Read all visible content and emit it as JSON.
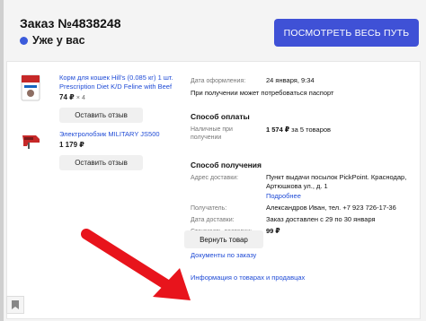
{
  "order": {
    "title": "Заказ №4838248",
    "status": "Уже у вас",
    "track_button": "ПОСМОТРЕТЬ ВЕСЬ ПУТЬ"
  },
  "products": [
    {
      "name": "Корм для кошек Hill's (0.085 кг) 1 шт. Prescription Diet K/D Feline with Beef",
      "price": "74 ₽",
      "qty": "× 4",
      "review_button": "Оставить отзыв",
      "icon": "cat-food-pack-icon"
    },
    {
      "name": "Электролобзик MILITARY JS500",
      "price": "1 179 ₽",
      "review_button": "Оставить отзыв",
      "icon": "jigsaw-icon"
    }
  ],
  "details": {
    "date_label": "Дата оформления:",
    "date_value": "24 января, 9:34",
    "passport_note": "При получении может потребоваться паспорт",
    "payment_title": "Способ оплаты",
    "payment_label": "Наличные при получении",
    "payment_value_amount": "1 574 ₽",
    "payment_value_rest": " за 5 товаров",
    "delivery_title": "Способ получения",
    "address_label": "Адрес доставки:",
    "address_value": "Пункт выдачи посылок PickPoint. Краснодар, Артюшкова ул., д. 1",
    "more_link": "Подробнее",
    "recipient_label": "Получатель:",
    "recipient_value": "Александров Иван, тел. +7 923 726-17-36",
    "delivery_date_label": "Дата доставки:",
    "delivery_date_value": "Заказ доставлен с 29 по 30 января",
    "delivery_cost_label": "Стоимость доставки:",
    "delivery_cost_value": "99 ₽"
  },
  "links": {
    "documents": "Документы по заказу",
    "sellers_info": "Информация о товарах и продавцах"
  },
  "return_button": "Вернуть товар",
  "colors": {
    "accent": "#3f51d6",
    "link": "#1f4bd6",
    "arrow": "#e8141c",
    "status_dot": "#3b5bdb"
  }
}
